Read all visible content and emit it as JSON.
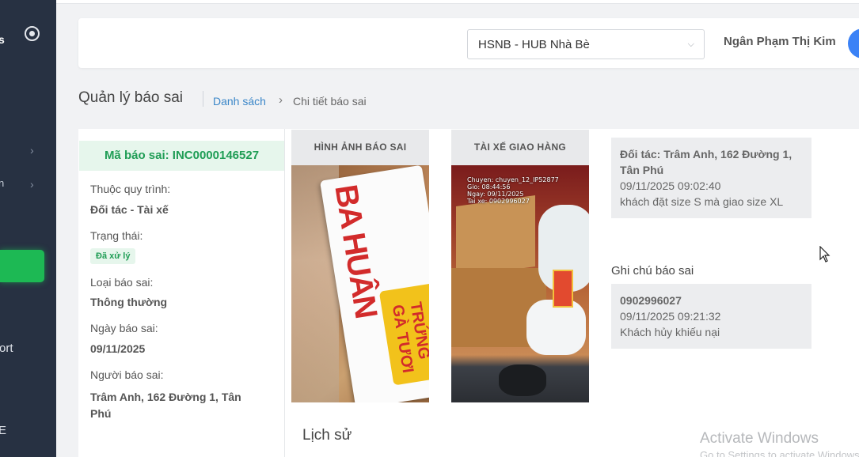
{
  "sidebar": {
    "logo_fragment": "s",
    "item_a_fragment": "n",
    "report_fragment": "ort",
    "bottom_fragment": "E"
  },
  "header": {
    "hub": "HSNB - HUB Nhà Bè",
    "user_name": "Ngân Phạm Thị Kim"
  },
  "page": {
    "title": "Quản lý báo sai",
    "breadcrumb_list": "Danh sách",
    "breadcrumb_detail": "Chi tiết báo sai"
  },
  "report": {
    "code": "Mã báo sai: INC0000146527",
    "process_label": "Thuộc quy trình:",
    "process_value": "Đối tác - Tài xế",
    "status_label": "Trạng thái:",
    "status_value": "Đã xử lý",
    "type_label": "Loại báo sai:",
    "type_value": "Thông thường",
    "date_label": "Ngày báo sai:",
    "date_value": "09/11/2025",
    "reporter_label": "Người báo sai:",
    "reporter_value": "Trâm Anh, 162 Đường 1, Tân Phú"
  },
  "images": {
    "report_header": "HÌNH ẢNH BÁO SAI",
    "driver_header": "TÀI XẾ GIAO HÀNG",
    "egg_brand": "BA HUÂN",
    "egg_label": "TRỨNG GÀ TƯƠI",
    "stamp_lines": [
      "Chuyen: chuyen_12_IP52877",
      "Gio: 08:44:56",
      "Ngay: 09/11/2025",
      "Tai xe: 0902996027"
    ]
  },
  "notes": {
    "partner_title": "Đối tác: Trâm Anh, 162 Đường 1, Tân Phú",
    "partner_time": "09/11/2025 09:02:40",
    "partner_text": "khách đặt size S mà giao size XL",
    "section_label": "Ghi chú báo sai",
    "note_title": "0902996027",
    "note_time": "09/11/2025 09:21:32",
    "note_text": "Khách hủy khiếu nại"
  },
  "history_title": "Lịch sử",
  "watermark": {
    "line1": "Activate Windows",
    "line2": "Go to Settings to activate Windows."
  },
  "colors": {
    "sidebar": "#273142",
    "accent_green": "#1db954",
    "link_blue": "#3a86c8"
  }
}
